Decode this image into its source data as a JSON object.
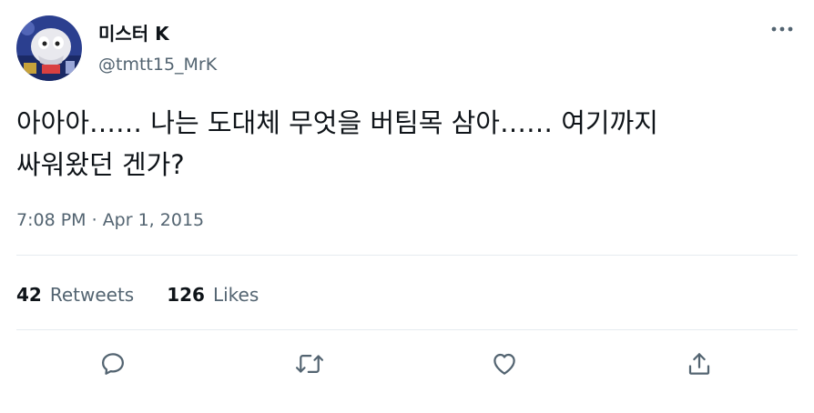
{
  "author": {
    "display_name": "미스터 K",
    "handle": "@tmtt15_MrK",
    "avatar_icon": "avatar-illustration-icon"
  },
  "tweet": {
    "text_line_1": "아아아…… 나는 도대체 무엇을 버팀목 삼아…… 여기까지",
    "text_line_2": "싸워왔던 겐가?",
    "time": "7:08 PM",
    "separator": " · ",
    "date": "Apr 1, 2015"
  },
  "stats": {
    "retweets_count": "42",
    "retweets_label": "Retweets",
    "likes_count": "126",
    "likes_label": "Likes"
  },
  "actions": {
    "reply_icon": "reply-icon",
    "retweet_icon": "retweet-icon",
    "like_icon": "heart-icon",
    "share_icon": "share-icon",
    "more_icon": "more-horizontal-icon"
  },
  "colors": {
    "text_primary": "#0f1419",
    "text_secondary": "#536471",
    "divider": "#e6ecf0",
    "icon": "#536471"
  }
}
